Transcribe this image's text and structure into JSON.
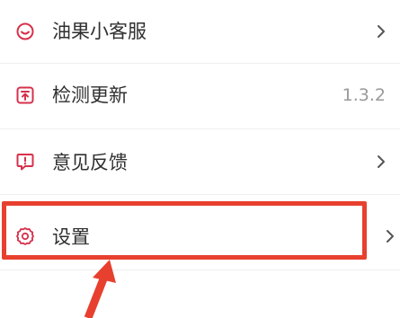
{
  "menu": {
    "items": [
      {
        "label": "油果小客服",
        "icon": "smile-chat-icon",
        "trailing": "chevron"
      },
      {
        "label": "检测更新",
        "icon": "update-check-icon",
        "trailing": "value",
        "value": "1.3.2"
      },
      {
        "label": "意见反馈",
        "icon": "feedback-icon",
        "trailing": "chevron"
      },
      {
        "label": "设置",
        "icon": "gear-icon",
        "trailing": "chevron"
      }
    ]
  },
  "colors": {
    "icon_accent": "#d6304b",
    "annotation_red": "#e8402f",
    "label_text": "#2f2f2f",
    "value_text": "#9a9a9a",
    "chevron": "#555555"
  }
}
